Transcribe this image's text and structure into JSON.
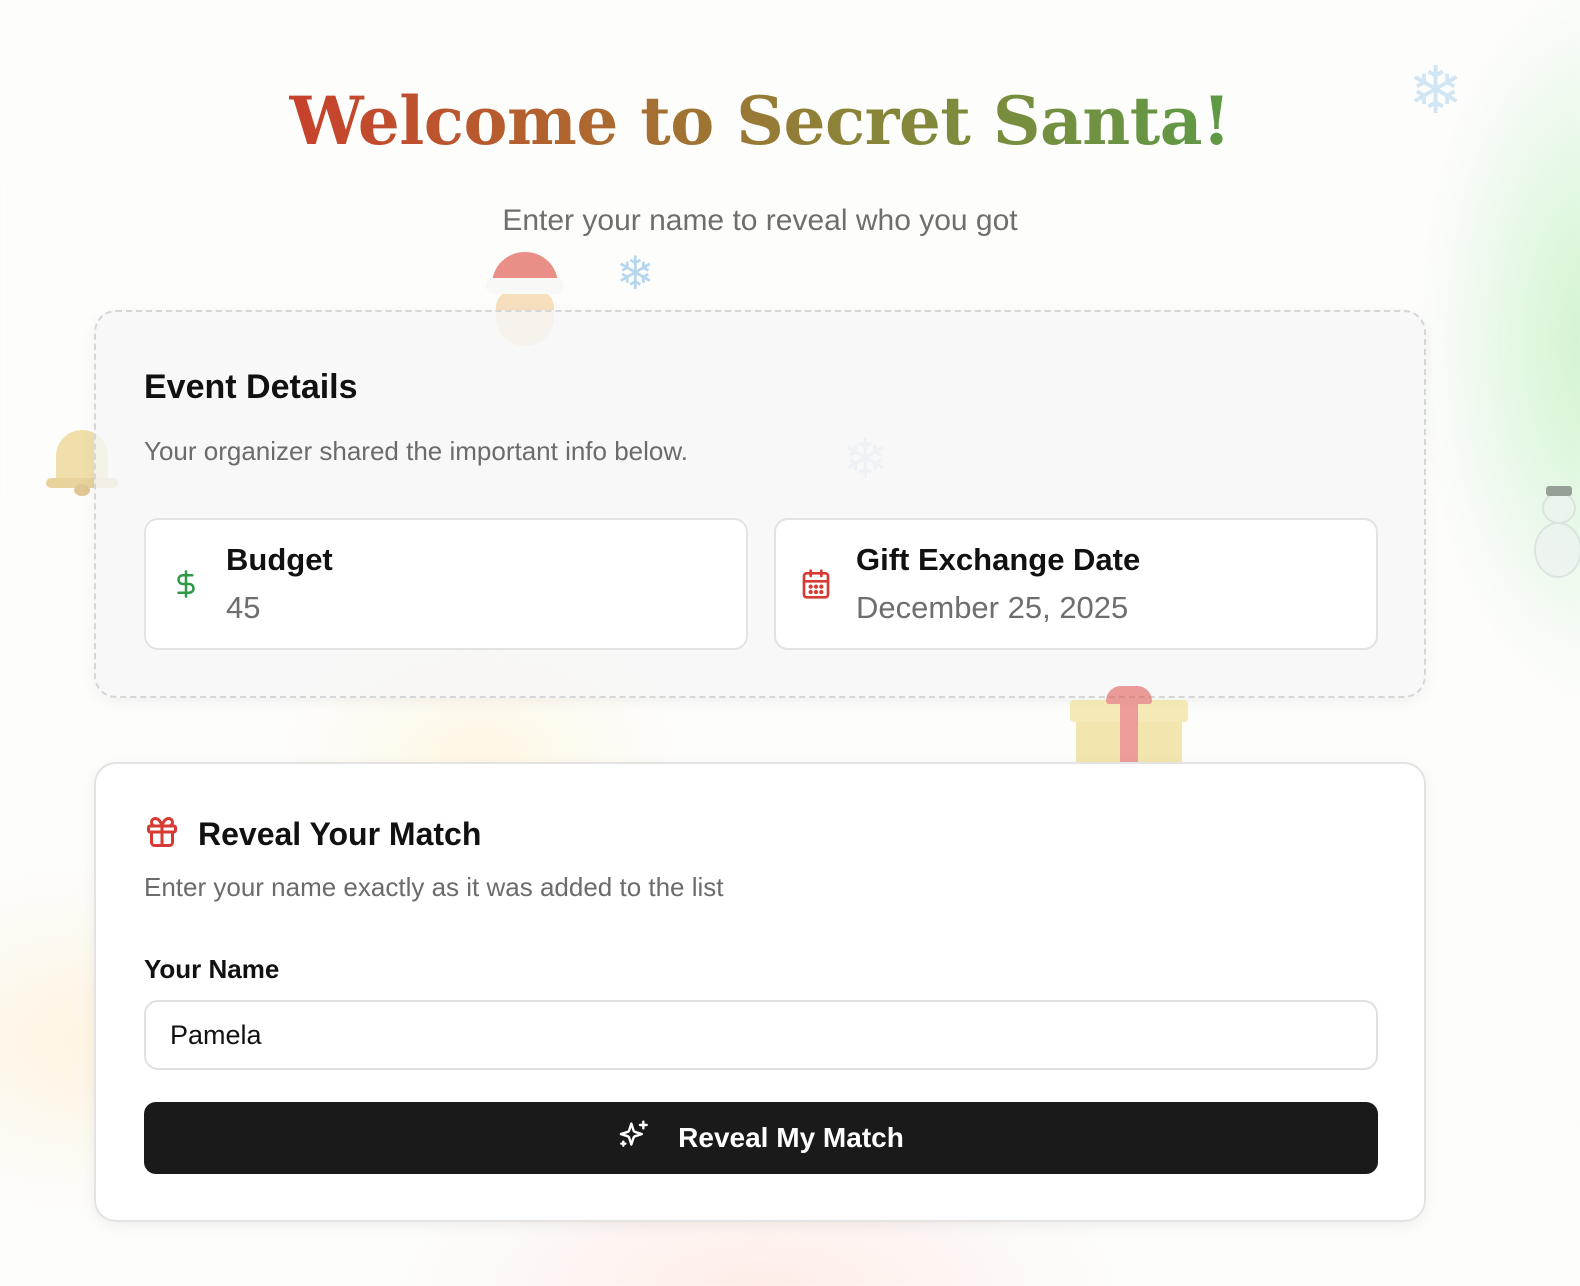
{
  "header": {
    "title": "Welcome to Secret Santa!",
    "subtitle": "Enter your name to reveal who you got"
  },
  "decorations": {
    "icons": [
      "snowflake-icon",
      "santa-icon",
      "bell-icon",
      "snowman-icon",
      "gift-box-icon"
    ],
    "snowflake_glyph": "❄"
  },
  "event_details": {
    "title": "Event Details",
    "description": "Your organizer shared the important info below.",
    "budget": {
      "icon": "dollar-icon",
      "label": "Budget",
      "value": "45"
    },
    "date": {
      "icon": "calendar-icon",
      "label": "Gift Exchange Date",
      "value": "December 25, 2025"
    }
  },
  "reveal": {
    "icon": "gift-icon",
    "title": "Reveal Your Match",
    "description": "Enter your name exactly as it was added to the list",
    "name_label": "Your Name",
    "name_value": "Pamela",
    "button_icon": "sparkles-icon",
    "button_label": "Reveal My Match"
  },
  "colors": {
    "title_gradient_start": "#c8402c",
    "title_gradient_end": "#5e9a46",
    "budget_icon": "#2f9a46",
    "calendar_icon": "#d63a33",
    "gift_icon": "#d63a33",
    "button_bg": "#1a1a1a"
  }
}
